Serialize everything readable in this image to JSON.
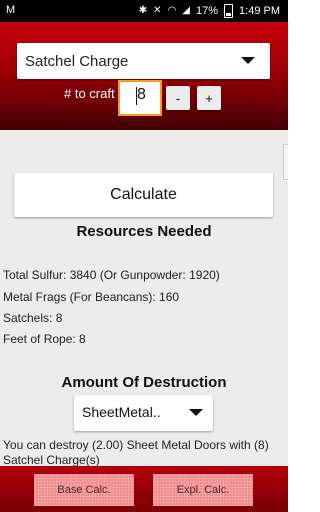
{
  "statusbar": {
    "left_icon": "M",
    "battery": "17%",
    "time": "1:49 PM",
    "icons": [
      "bluetooth-icon",
      "mute-icon",
      "wifi-icon",
      "signal-icon",
      "battery-icon"
    ]
  },
  "header": {
    "selected_item": "Satchel Charge",
    "craft_label": "# to craft",
    "quantity": "8",
    "minus_label": "-",
    "plus_label": "+"
  },
  "main": {
    "calculate_label": "Calculate",
    "resources_heading": "Resources Needed",
    "resources": [
      "Total Sulfur:  3840   (Or Gunpowder:  1920)",
      "Metal Frags (For Beancans):  160",
      "Satchels:  8",
      "Feet of Rope:  8"
    ],
    "destruction_heading": "Amount Of Destruction",
    "target_selected": "SheetMetal..",
    "destroy_text": "You can destroy (2.00) Sheet Metal Doors with (8) Satchel Charge(s)"
  },
  "footer": {
    "base_calc_label": "Base Calc.",
    "expl_calc_label": "Expl. Calc."
  },
  "colors": {
    "header_red": "#c7000b",
    "footer_red": "#b3000a",
    "input_focus": "#ff9a1f",
    "content_bg": "#ececec"
  }
}
